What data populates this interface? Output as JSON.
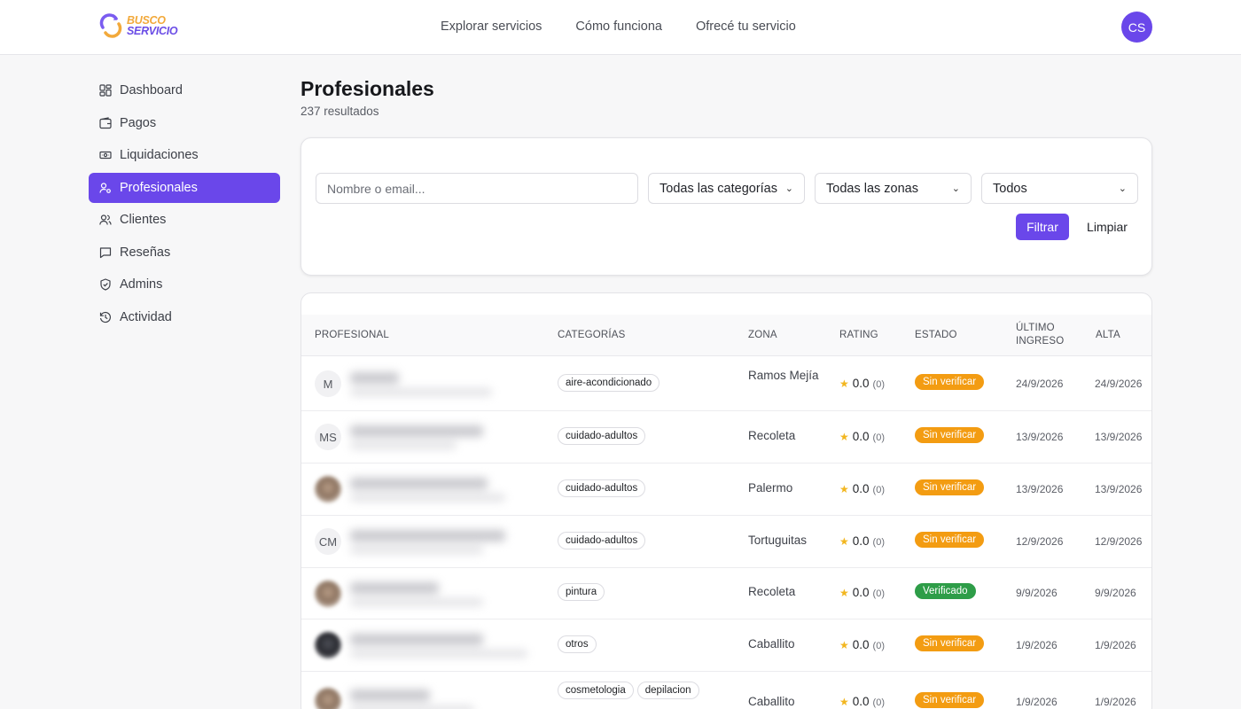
{
  "header": {
    "logo": {
      "line1": "BUSCO",
      "line2": "SERVICIO"
    },
    "nav": [
      "Explorar servicios",
      "Cómo funciona",
      "Ofrecé tu servicio"
    ],
    "avatar_initials": "CS"
  },
  "sidebar": {
    "items": [
      {
        "label": "Dashboard",
        "icon": "dashboard-icon",
        "active": false
      },
      {
        "label": "Pagos",
        "icon": "wallet-icon",
        "active": false
      },
      {
        "label": "Liquidaciones",
        "icon": "banknote-icon",
        "active": false
      },
      {
        "label": "Profesionales",
        "icon": "user-cog-icon",
        "active": true
      },
      {
        "label": "Clientes",
        "icon": "users-icon",
        "active": false
      },
      {
        "label": "Reseñas",
        "icon": "message-icon",
        "active": false
      },
      {
        "label": "Admins",
        "icon": "shield-icon",
        "active": false
      },
      {
        "label": "Actividad",
        "icon": "history-icon",
        "active": false
      }
    ]
  },
  "main": {
    "title": "Profesionales",
    "subtitle": "237 resultados",
    "filters": {
      "search_placeholder": "Nombre o email...",
      "categoria": "Todas las categorías",
      "zona": "Todas las zonas",
      "estado": "Todos",
      "filtrar_label": "Filtrar",
      "limpiar_label": "Limpiar"
    },
    "table": {
      "columns": [
        "PROFESIONAL",
        "CATEGORÍAS",
        "ZONA",
        "RATING",
        "ESTADO",
        "ÚLTIMO INGRESO",
        "ALTA"
      ],
      "rows": [
        {
          "initials": "M",
          "photo": false,
          "categories": [
            "aire-acondicionado"
          ],
          "zona": "Ramos Mejía",
          "rating": "0.0",
          "reviews": "(0)",
          "estado": "Sin verificar",
          "verified": false,
          "ultimo": "24/9/2026",
          "alta": "24/9/2026"
        },
        {
          "initials": "MS",
          "photo": false,
          "categories": [
            "cuidado-adultos"
          ],
          "zona": "Recoleta",
          "rating": "0.0",
          "reviews": "(0)",
          "estado": "Sin verificar",
          "verified": false,
          "ultimo": "13/9/2026",
          "alta": "13/9/2026"
        },
        {
          "initials": "",
          "photo": true,
          "categories": [
            "cuidado-adultos"
          ],
          "zona": "Palermo",
          "rating": "0.0",
          "reviews": "(0)",
          "estado": "Sin verificar",
          "verified": false,
          "ultimo": "13/9/2026",
          "alta": "13/9/2026"
        },
        {
          "initials": "CM",
          "photo": false,
          "categories": [
            "cuidado-adultos"
          ],
          "zona": "Tortuguitas",
          "rating": "0.0",
          "reviews": "(0)",
          "estado": "Sin verificar",
          "verified": false,
          "ultimo": "12/9/2026",
          "alta": "12/9/2026"
        },
        {
          "initials": "",
          "photo": true,
          "categories": [
            "pintura"
          ],
          "zona": "Recoleta",
          "rating": "0.0",
          "reviews": "(0)",
          "estado": "Verificado",
          "verified": true,
          "ultimo": "9/9/2026",
          "alta": "9/9/2026"
        },
        {
          "initials": "",
          "photo": true,
          "categories": [
            "otros"
          ],
          "zona": "Caballito",
          "rating": "0.0",
          "reviews": "(0)",
          "estado": "Sin verificar",
          "verified": false,
          "ultimo": "1/9/2026",
          "alta": "1/9/2026"
        },
        {
          "initials": "",
          "photo": true,
          "categories": [
            "cosmetologia",
            "depilacion"
          ],
          "zona": "Caballito",
          "rating": "0.0",
          "reviews": "(0)",
          "estado": "Sin verificar",
          "verified": false,
          "ultimo": "1/9/2026",
          "alta": "1/9/2026"
        }
      ]
    }
  },
  "colors": {
    "accent": "#6a47ea",
    "warning": "#f39c12",
    "success": "#2e9d48",
    "star": "#f2b61f"
  }
}
